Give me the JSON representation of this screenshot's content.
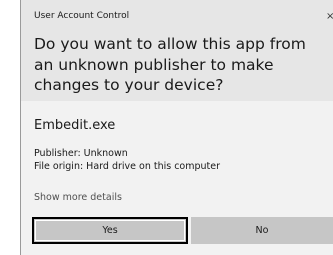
{
  "window": {
    "title": "User Account Control",
    "close_glyph": "×"
  },
  "prompt": {
    "question": "Do you want to allow this app from an unknown publisher to make changes to your device?"
  },
  "app": {
    "name": "Embedit.exe",
    "publisher": "Publisher: Unknown",
    "origin": "File origin: Hard drive on this computer"
  },
  "details_link": "Show more details",
  "buttons": {
    "yes": "Yes",
    "no": "No"
  },
  "colors": {
    "header_bg": "#e6e6e6",
    "body_bg": "#f2f2f2",
    "button_bg": "#c6c6c6",
    "focus_border": "#000000"
  }
}
